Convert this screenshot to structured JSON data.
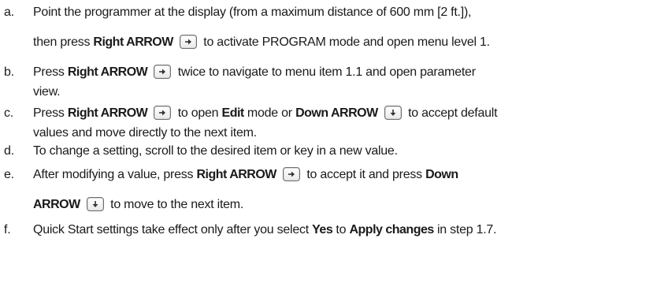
{
  "steps": [
    {
      "letter": "a.",
      "line1": [
        "Point the programmer at the display (from a maximum distance of 600 mm [2 ft.]),"
      ],
      "line2": [
        "then press ",
        "Right ARROW",
        " to activate PROGRAM mode and open menu level 1."
      ]
    },
    {
      "letter": "b.",
      "line1": [
        "Press ",
        "Right ARROW",
        " twice to navigate to menu item 1.1 and open parameter"
      ],
      "line2": [
        "view."
      ]
    },
    {
      "letter": "c.",
      "line1": [
        "Press ",
        "Right ARROW",
        " to open ",
        "Edit",
        " mode or ",
        "Down ARROW",
        " to accept default"
      ],
      "line2": [
        "values and move directly to the next item."
      ]
    },
    {
      "letter": "d.",
      "line1": [
        "To change a setting, scroll to the desired item or key in a new value."
      ]
    },
    {
      "letter": "e.",
      "line1": [
        "After modifying a value, press ",
        "Right ARROW",
        " to accept it and press ",
        "Down"
      ],
      "line2": [
        "ARROW",
        " to move to the next item."
      ]
    },
    {
      "letter": "f.",
      "line1": [
        "Quick Start settings take effect only after you select ",
        "Yes",
        " to ",
        "Apply changes",
        " in step 1.7."
      ]
    }
  ],
  "icons": {
    "right": "right-arrow-key-icon",
    "down": "down-arrow-key-icon"
  },
  "colors": {
    "text": "#1a1a1a",
    "key_border": "#6f6f6f"
  }
}
